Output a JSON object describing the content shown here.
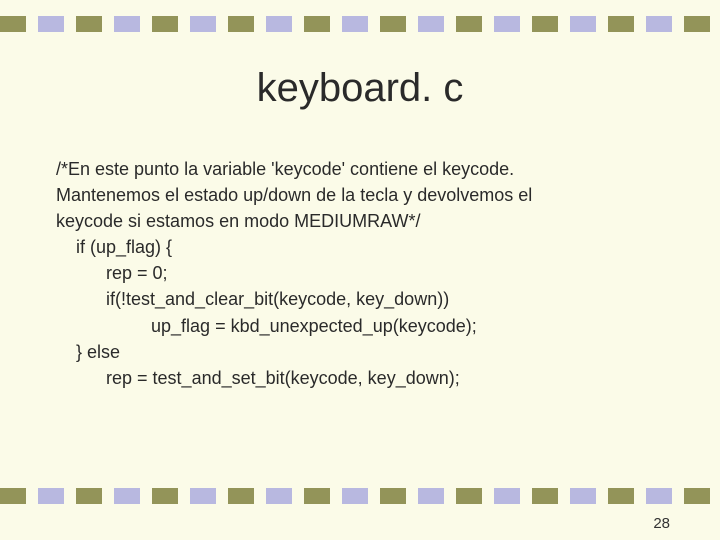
{
  "title": "keyboard. c",
  "code": {
    "l1": "/*En este punto la variable 'keycode' contiene el keycode.",
    "l2": "Mantenemos el estado up/down de la tecla y devolvemos el",
    "l3": "keycode si estamos en modo MEDIUMRAW*/",
    "l4": "    if (up_flag) {",
    "l5": "          rep = 0;",
    "l6": "          if(!test_and_clear_bit(keycode, key_down))",
    "l7": "                   up_flag = kbd_unexpected_up(keycode);",
    "l8": "    } else",
    "l9": "          rep = test_and_set_bit(keycode, key_down);"
  },
  "page_number": "28"
}
